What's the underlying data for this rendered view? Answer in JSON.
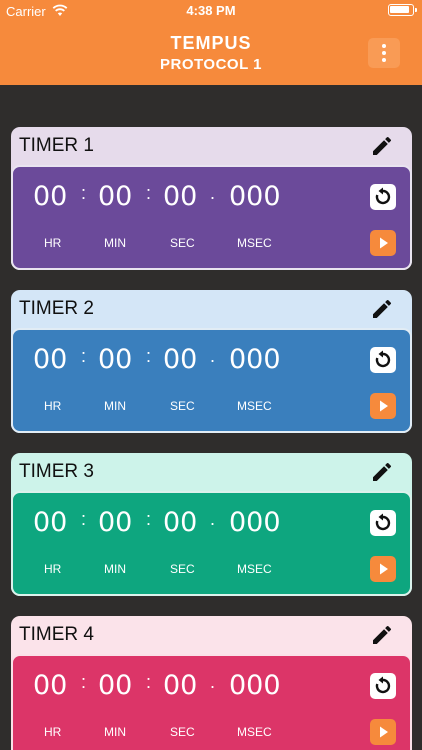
{
  "status_bar": {
    "carrier": "Carrier",
    "time": "4:38 PM"
  },
  "header": {
    "logo": "TEMPUS",
    "subtitle": "PROTOCOL 1",
    "menu_icon": "more-vertical-icon"
  },
  "accent_color": "#f68a3c",
  "timers": [
    {
      "title": "TIMER 1",
      "hr": "00",
      "min": "00",
      "sec": "00",
      "msec": "000",
      "card_color": "#e6dbeb",
      "face_color": "#6b4a9a"
    },
    {
      "title": "TIMER 2",
      "hr": "00",
      "min": "00",
      "sec": "00",
      "msec": "000",
      "card_color": "#d4e6f7",
      "face_color": "#3a7fbd"
    },
    {
      "title": "TIMER 3",
      "hr": "00",
      "min": "00",
      "sec": "00",
      "msec": "000",
      "card_color": "#cdf3ea",
      "face_color": "#0ea67f"
    },
    {
      "title": "TIMER 4",
      "hr": "00",
      "min": "00",
      "sec": "00",
      "msec": "000",
      "card_color": "#fbe3ea",
      "face_color": "#dc3568"
    }
  ],
  "units": {
    "hr": "HR",
    "min": "MIN",
    "sec": "SEC",
    "msec": "MSEC"
  },
  "separators": {
    "colon": ":",
    "dot": "."
  }
}
